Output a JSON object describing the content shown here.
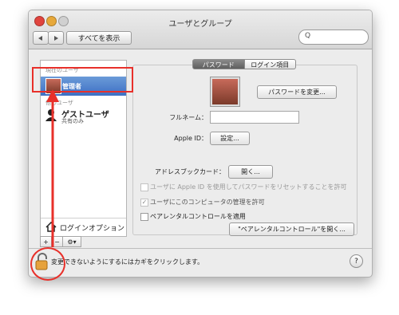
{
  "window": {
    "title": "ユーザとグループ"
  },
  "toolbar": {
    "show_all_label": "すべてを表示",
    "search_placeholder": "Q"
  },
  "sidebar": {
    "current_user_header": "現在のユーザ",
    "current_user_name": "管理者",
    "other_users_header": "他のユーザ",
    "guest_name": "ゲストユーザ",
    "guest_subtitle": "共有のみ",
    "login_options_label": "ログインオプション",
    "add_label": "+",
    "remove_label": "−",
    "gear_label": "⚙▾"
  },
  "tabs": [
    {
      "label": "パスワード",
      "selected": true
    },
    {
      "label": "ログイン項目",
      "selected": false
    }
  ],
  "password_panel": {
    "change_password_button": "パスワードを変更...",
    "full_name_label": "フルネーム：",
    "full_name_value": "",
    "apple_id_label": "Apple ID：",
    "apple_id_button": "設定...",
    "address_book_label": "アドレスブックカード：",
    "address_book_button": "開く...",
    "checkbox_reset_password": "ユーザに Apple ID を使用してパスワードをリセットすることを許可",
    "checkbox_admin": "ユーザにこのコンピュータの管理を許可",
    "checkbox_parental": "ペアレンタルコントロールを適用",
    "open_parental_button": "\"ペアレンタルコントロール\"を開く..."
  },
  "footer": {
    "lock_text": "変更できないようにするにはカギをクリックします。",
    "help_label": "?"
  },
  "colors": {
    "selection": "#3d6fc4",
    "annotation_red": "#e8302a"
  }
}
